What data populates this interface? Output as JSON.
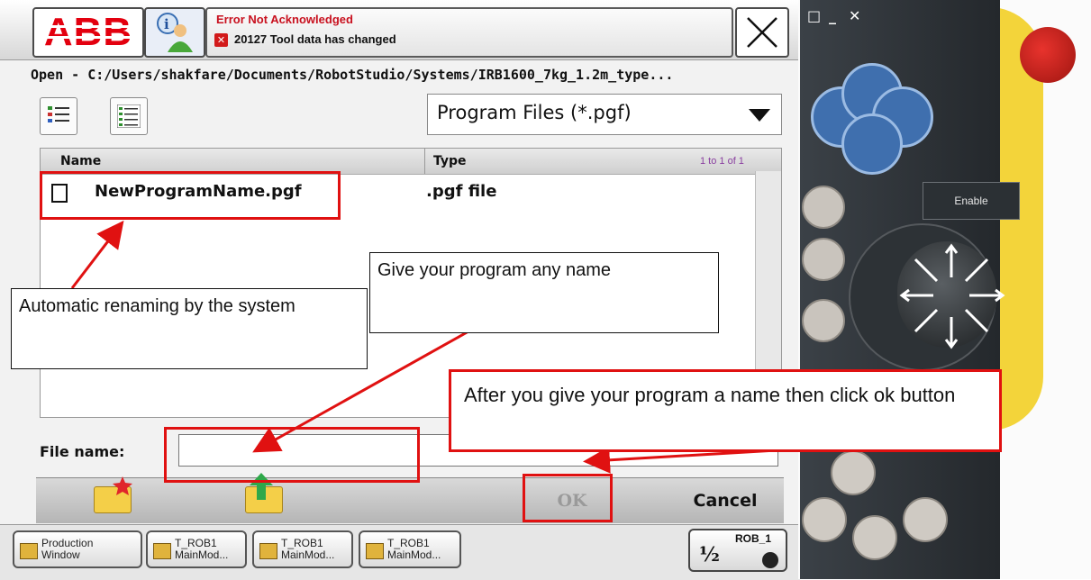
{
  "header": {
    "logo_text": "ABB",
    "status_title": "Error Not Acknowledged",
    "status_message": "20127 Tool data has changed",
    "close_glyph": "✕"
  },
  "path": "Open - C:/Users/shakfare/Documents/RobotStudio/Systems/IRB1600_7kg_1.2m_type...",
  "filter": {
    "selected": "Program Files (*.pgf)"
  },
  "list": {
    "columns": [
      "Name",
      "Type"
    ],
    "range": "1 to 1 of 1",
    "rows": [
      {
        "name": "NewProgramName.pgf",
        "type": ".pgf file"
      }
    ]
  },
  "filename": {
    "label": "File name:",
    "value": ""
  },
  "commands": {
    "ok": "OK",
    "cancel": "Cancel"
  },
  "taskbar": {
    "items": [
      "Production\nWindow",
      "T_ROB1\nMainMod...",
      "T_ROB1\nMainMod...",
      "T_ROB1\nMainMod..."
    ],
    "robot": {
      "label": "ROB_1",
      "speed": "½"
    }
  },
  "pendant": {
    "enable_label": "Enable"
  },
  "annotations": {
    "rename": "Automatic renaming by the system",
    "name": "Give your program any name",
    "ok": "After you give your program a name then click ok button"
  },
  "colors": {
    "abb_red": "#e3000f",
    "annotation_red": "#e01111",
    "pendant_blue": "#3f6fae",
    "pendant_yellow": "#f3d43a"
  }
}
